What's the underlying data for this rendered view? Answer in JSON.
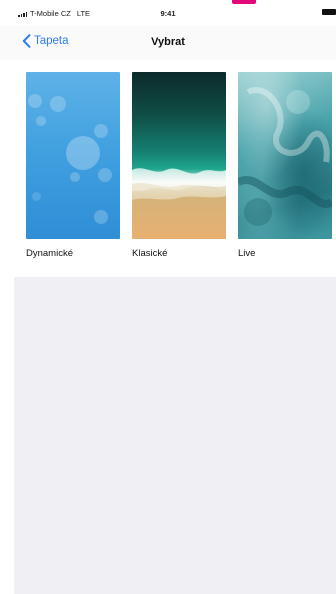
{
  "status_bar": {
    "carrier": "T-Mobile CZ",
    "network": "LTE",
    "time": "9:41"
  },
  "nav": {
    "back_label": "Tapeta",
    "title": "Vybrat"
  },
  "wallpapers": [
    {
      "label": "Dynamické",
      "icon": "dynamic-wallpaper-thumbnail"
    },
    {
      "label": "Klasické",
      "icon": "classic-beach-wallpaper-thumbnail"
    },
    {
      "label": "Live",
      "icon": "live-ink-wallpaper-thumbnail"
    }
  ],
  "colors": {
    "accent": "#2d7cf6",
    "background": "#efeff4",
    "marker": "#e4097a"
  }
}
